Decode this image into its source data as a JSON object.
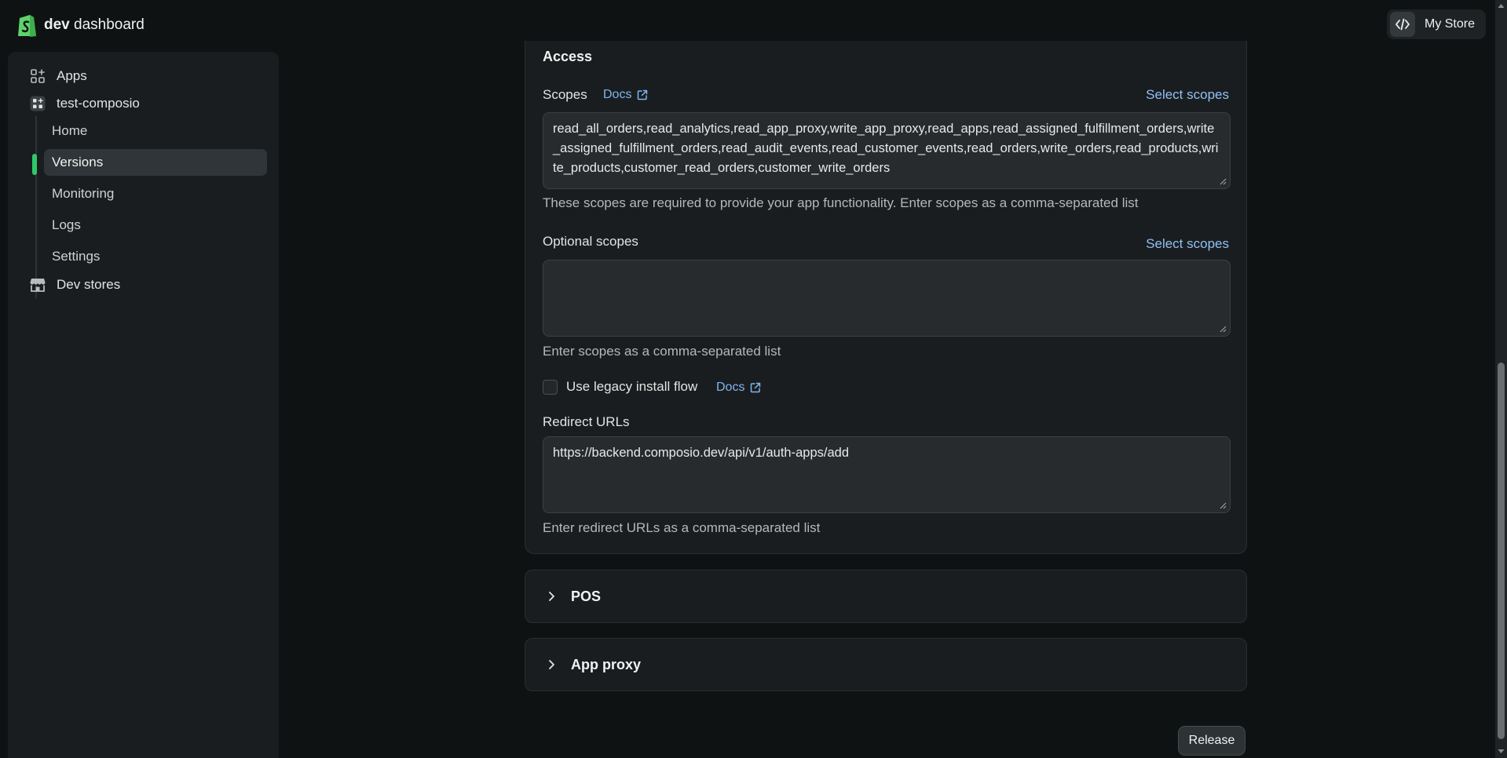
{
  "topbar": {
    "brand_bold": "dev",
    "brand_rest": " dashboard",
    "store_label": "My Store"
  },
  "sidebar": {
    "apps": "Apps",
    "app_name": "test-composio",
    "sub_items": [
      "Home",
      "Versions",
      "Monitoring",
      "Logs",
      "Settings"
    ],
    "dev_stores": "Dev stores"
  },
  "access": {
    "title": "Access",
    "scopes_label": "Scopes",
    "docs_label": "Docs",
    "select_scopes": "Select scopes",
    "scopes_value": "read_all_orders,read_analytics,read_app_proxy,write_app_proxy,read_apps,read_assigned_fulfillment_orders,write_assigned_fulfillment_orders,read_audit_events,read_customer_events,read_orders,write_orders,read_products,write_products,customer_read_orders,customer_write_orders",
    "scopes_help": "These scopes are required to provide your app functionality. Enter scopes as a comma-separated list",
    "optional_label": "Optional scopes",
    "optional_value": "",
    "optional_help": "Enter scopes as a comma-separated list",
    "legacy_label": "Use legacy install flow",
    "redirect_label": "Redirect URLs",
    "redirect_value": "https://backend.composio.dev/api/v1/auth-apps/add",
    "redirect_help": "Enter redirect URLs as a comma-separated list"
  },
  "sections": {
    "pos": "POS",
    "app_proxy": "App proxy"
  },
  "footer": {
    "release": "Release"
  },
  "colors": {
    "accent_green": "#2fc96a",
    "link_blue": "#8fc0f5",
    "background": "#0f1213",
    "panel": "#1a1d1f"
  }
}
